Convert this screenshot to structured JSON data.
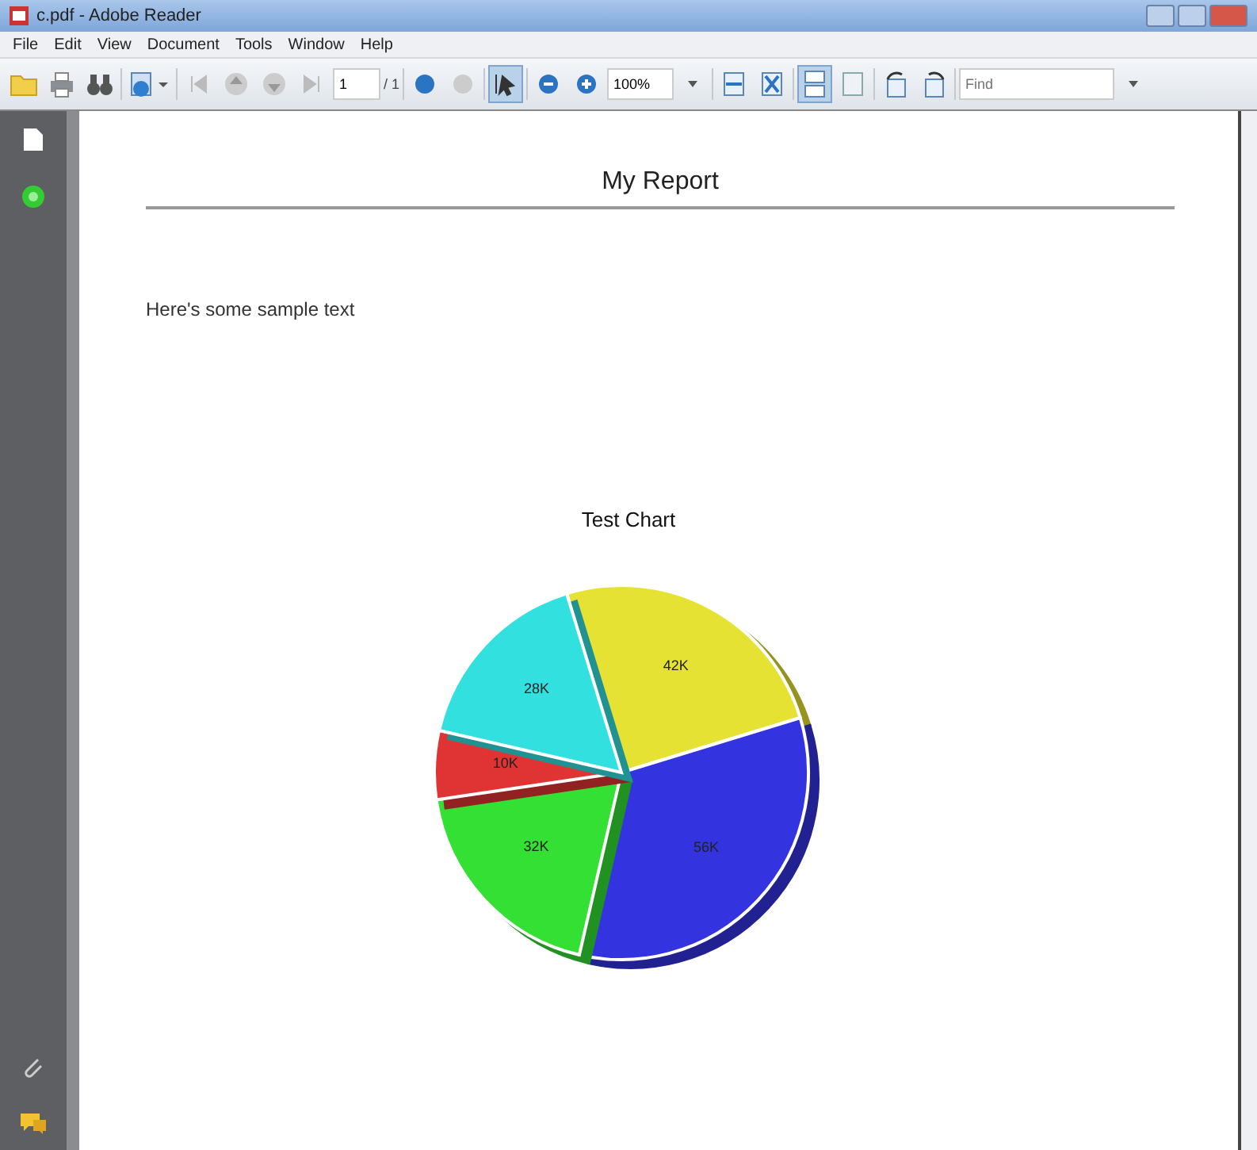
{
  "window": {
    "title": "c.pdf - Adobe Reader"
  },
  "menu": [
    "File",
    "Edit",
    "View",
    "Document",
    "Tools",
    "Window",
    "Help"
  ],
  "toolbar": {
    "page": "1",
    "page_count": "/ 1",
    "zoom": "100%",
    "find_placeholder": "Find"
  },
  "document": {
    "heading": "My Report",
    "text": "Here's some sample text",
    "chart_data": {
      "type": "pie",
      "title": "Test Chart",
      "values": [
        42,
        56,
        32,
        10,
        28
      ],
      "value_labels": [
        "42K",
        "56K",
        "32K",
        "10K",
        "28K"
      ],
      "colors": [
        "#e6e233",
        "#3333e0",
        "#33e033",
        "#e03333",
        "#33e0e0"
      ]
    }
  }
}
